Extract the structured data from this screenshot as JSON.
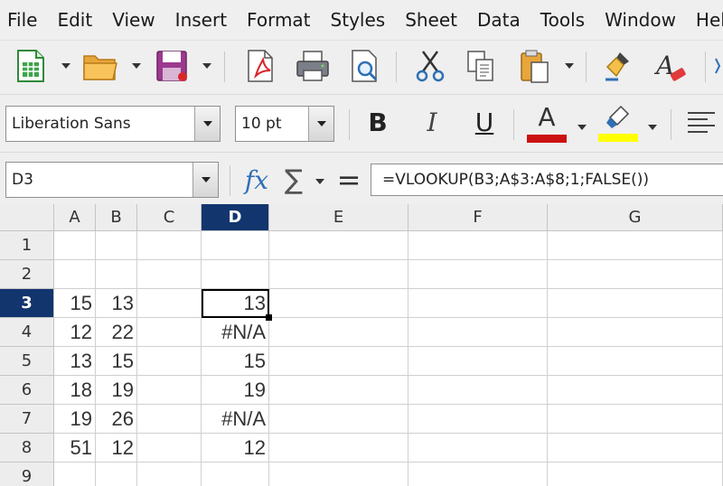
{
  "menubar": {
    "items": [
      {
        "label": "File",
        "name": "menu-file"
      },
      {
        "label": "Edit",
        "name": "menu-edit"
      },
      {
        "label": "View",
        "name": "menu-view"
      },
      {
        "label": "Insert",
        "name": "menu-insert"
      },
      {
        "label": "Format",
        "name": "menu-format"
      },
      {
        "label": "Styles",
        "name": "menu-styles"
      },
      {
        "label": "Sheet",
        "name": "menu-sheet"
      },
      {
        "label": "Data",
        "name": "menu-data"
      },
      {
        "label": "Tools",
        "name": "menu-tools"
      },
      {
        "label": "Window",
        "name": "menu-window"
      },
      {
        "label": "Help",
        "name": "menu-help"
      }
    ]
  },
  "toolbar": {
    "icons": [
      "new-spreadsheet-icon",
      "open-folder-icon",
      "save-icon",
      "export-pdf-icon",
      "print-icon",
      "print-preview-icon",
      "cut-icon",
      "copy-icon",
      "paste-icon",
      "clone-formatting-icon",
      "clear-formatting-icon"
    ]
  },
  "format_toolbar": {
    "font_name": "Liberation Sans",
    "font_size": "10 pt",
    "bold_label": "B",
    "italic_label": "I",
    "underline_label": "U",
    "font_color_label": "A",
    "font_color": "#cc1111",
    "highlight_color": "#ffff00"
  },
  "formula_bar": {
    "name_box": "D3",
    "fx_label": "fx",
    "sum_label": "∑",
    "equals_label": "=",
    "formula": "=VLOOKUP(B3;A$3:A$8;1;FALSE())"
  },
  "grid": {
    "columns": [
      "A",
      "B",
      "C",
      "D",
      "E",
      "F",
      "G"
    ],
    "active_column": "D",
    "rows": [
      "1",
      "2",
      "3",
      "4",
      "5",
      "6",
      "7",
      "8",
      "9"
    ],
    "active_row": "3",
    "active_cell": "D3",
    "cells": {
      "A3": "15",
      "B3": "13",
      "D3": "13",
      "A4": "12",
      "B4": "22",
      "D4": "#N/A",
      "A5": "13",
      "B5": "15",
      "D5": "15",
      "A6": "18",
      "B6": "19",
      "D6": "19",
      "A7": "19",
      "B7": "26",
      "D7": "#N/A",
      "A8": "51",
      "B8": "12",
      "D8": "12"
    }
  }
}
